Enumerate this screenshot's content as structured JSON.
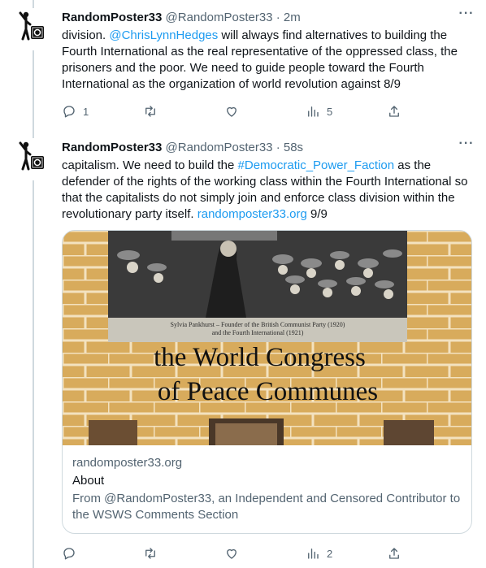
{
  "tweets": [
    {
      "name": "RandomPoster33",
      "handle": "@RandomPoster33",
      "sep": "·",
      "time": "2m",
      "more": "···",
      "text_parts": [
        "division. ",
        "@ChrisLynnHedges",
        " will always find alternatives to building the Fourth International as the real representative of the oppressed class, the prisoners and the poor. We need to guide people toward the Fourth International as the organization of world revolution against 8/9"
      ],
      "replies": "1",
      "retweets": "",
      "likes": "",
      "views": "5"
    },
    {
      "name": "RandomPoster33",
      "handle": "@RandomPoster33",
      "sep": "·",
      "time": "58s",
      "more": "···",
      "text_parts": [
        "capitalism. We need to build the ",
        "#Democratic_Power_Faction",
        " as the defender of the rights of the working class within the Fourth International so that the capitalists do not simply join and enforce class division within the revolutionary party itself. ",
        "randomposter33.org",
        " 9/9"
      ],
      "replies": "",
      "retweets": "",
      "likes": "",
      "views": "2",
      "card": {
        "image_caption_line1": "Sylvia Pankhurst – Founder of the British Communist Party (1920)",
        "image_caption_line2": "and the Fourth International (1921)",
        "image_title_line1": "the World Congress",
        "image_title_line2": "of Peace Communes",
        "domain": "randomposter33.org",
        "title": "About",
        "description": "From @RandomPoster33, an Independent and Censored Contributor to the WSWS Comments Section"
      }
    }
  ],
  "colors": {
    "link": "#1d9bf0",
    "muted": "#536471",
    "line": "#cfd9de",
    "brick": "#d8ab5c"
  },
  "icons": [
    "avatar-figure-icon",
    "reply-icon",
    "retweet-icon",
    "like-icon",
    "views-icon",
    "share-icon",
    "more-icon"
  ]
}
